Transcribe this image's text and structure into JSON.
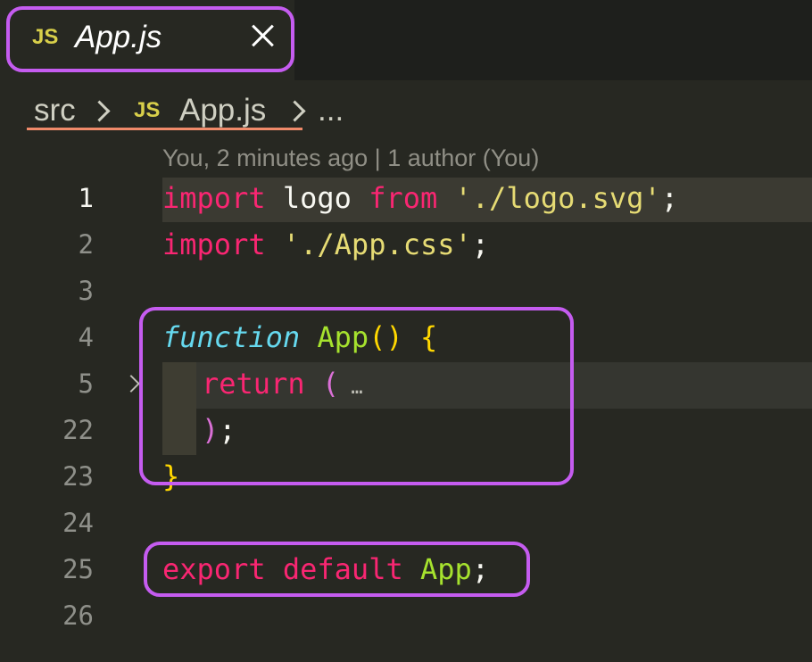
{
  "tab": {
    "badge": "JS",
    "title": "App.js",
    "close_icon": "close-icon"
  },
  "breadcrumb": {
    "folder": "src",
    "file_badge": "JS",
    "file": "App.js",
    "more": "..."
  },
  "blame": "You, 2 minutes ago | 1 author (You)",
  "gutter": [
    "1",
    "2",
    "3",
    "4",
    "5",
    "22",
    "23",
    "24",
    "25",
    "26"
  ],
  "code": {
    "l1": {
      "kw1": "import",
      "name": " logo ",
      "kw2": "from",
      "sp": " ",
      "str": "'./logo.svg'",
      "semi": ";"
    },
    "l2": {
      "kw": "import",
      "sp": " ",
      "str": "'./App.css'",
      "semi": ";"
    },
    "l4": {
      "kw": "function",
      "sp": " ",
      "name": "App",
      "parens": "()",
      "sp2": " ",
      "brace": "{"
    },
    "l5": {
      "kw": "return",
      "sp": " ",
      "paren": "(",
      "ellipsis": " …"
    },
    "l22": {
      "paren": ")",
      "semi": ";"
    },
    "l23": {
      "brace": "}"
    },
    "l25": {
      "kw1": "export",
      "sp": " ",
      "kw2": "default",
      "sp2": " ",
      "name": "App",
      "semi": ";"
    }
  },
  "colors": {
    "highlight": "#c55cf0",
    "underline": "#f08a6a",
    "background": "#272822"
  }
}
